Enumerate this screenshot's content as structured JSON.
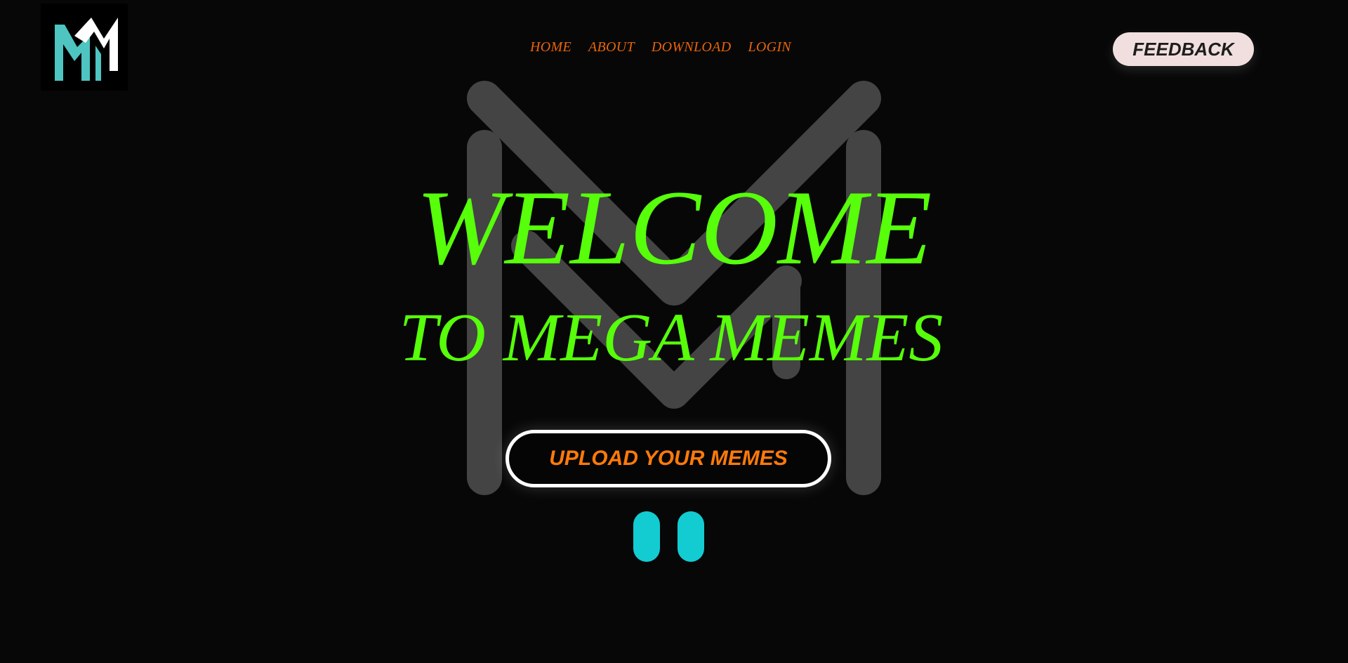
{
  "logo": {
    "icon": "mm-monogram-icon",
    "colors": [
      "#4ec5c1",
      "#ffffff"
    ]
  },
  "nav": {
    "items": [
      "HOME",
      "ABOUT",
      "DOWNLOAD",
      "LOGIN"
    ],
    "color": "#e8640a"
  },
  "feedback": {
    "label": "FEEDBACK",
    "bg": "#f1dfdf"
  },
  "hero": {
    "title_line1": "WELCOME",
    "title_line2": "TO MEGA MEMES",
    "title_color": "#57ff0a",
    "background_icon": "mm-watermark-icon"
  },
  "upload": {
    "label": "UPLOAD YOUR MEMES",
    "color": "#ff7a0a"
  },
  "media_control": {
    "icon": "pause-icon",
    "color": "#13ccd2"
  }
}
